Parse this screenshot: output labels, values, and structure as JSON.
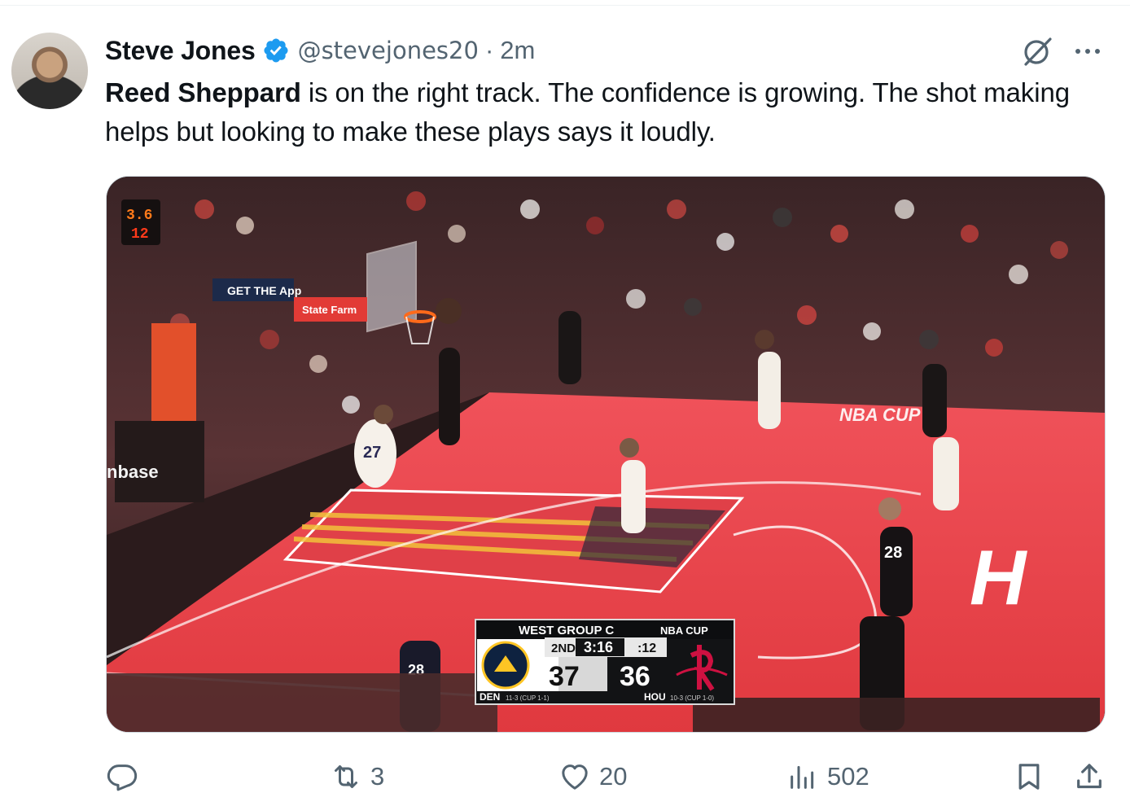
{
  "tweet": {
    "author_name": "Steve Jones",
    "handle": "@stevejones20",
    "separator": "·",
    "time": "2m",
    "text_mention": "Reed Sheppard",
    "text_body": " is on the right track. The confidence is growing. The shot making helps but looking to make these plays says it loudly."
  },
  "media": {
    "scoreboard": {
      "header": "WEST GROUP C",
      "cup": "NBA CUP",
      "period": "2ND",
      "clock": "3:16",
      "shot_clock": ":12",
      "away_score": "37",
      "home_score": "36",
      "away_team": "DEN",
      "away_record": "11-3 (CUP 1-1)",
      "home_team": "HOU",
      "home_record": "10-3 (CUP 1-0)"
    },
    "arena_text": {
      "shot_clock_display": "3.6",
      "shot_clock_sub": "12",
      "coinbase": "nbase",
      "court_logo": "NBA CUP",
      "court_big": "H",
      "banner": "GET THE App",
      "sponsor": "State Farm",
      "jersey_27": "27",
      "jersey_28": "28",
      "jersey_28_bench": "28"
    }
  },
  "actions": {
    "reply_count": "",
    "retweet_count": "3",
    "like_count": "20",
    "views_count": "502"
  },
  "colors": {
    "verified_blue": "#1d9bf0",
    "icon_gray": "#536471",
    "court_red": "#e8484a"
  }
}
